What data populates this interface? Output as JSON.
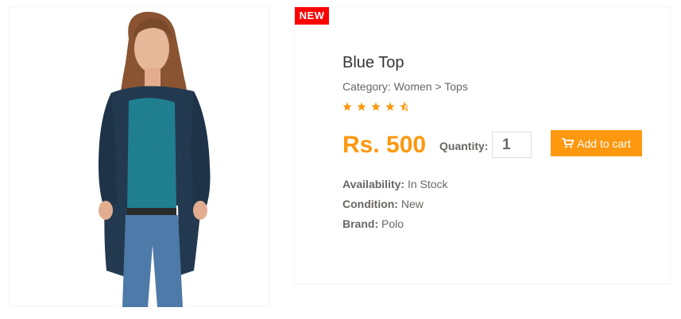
{
  "product": {
    "badge": "NEW",
    "name": "Blue Top",
    "category": "Category: Women > Tops",
    "rating": 4.5,
    "price": "Rs. 500",
    "quantity_label": "Quantity:",
    "quantity_value": "1",
    "add_to_cart_label": "Add to cart",
    "availability_label": "Availability:",
    "availability_value": "In Stock",
    "condition_label": "Condition:",
    "condition_value": "New",
    "brand_label": "Brand:",
    "brand_value": "Polo"
  },
  "icons": {
    "rating": "star-icon",
    "cart": "shopping-cart-icon"
  },
  "colors": {
    "accent": "#fe980f",
    "badge": "#ff0000",
    "title": "#363432",
    "text": "#696763"
  }
}
